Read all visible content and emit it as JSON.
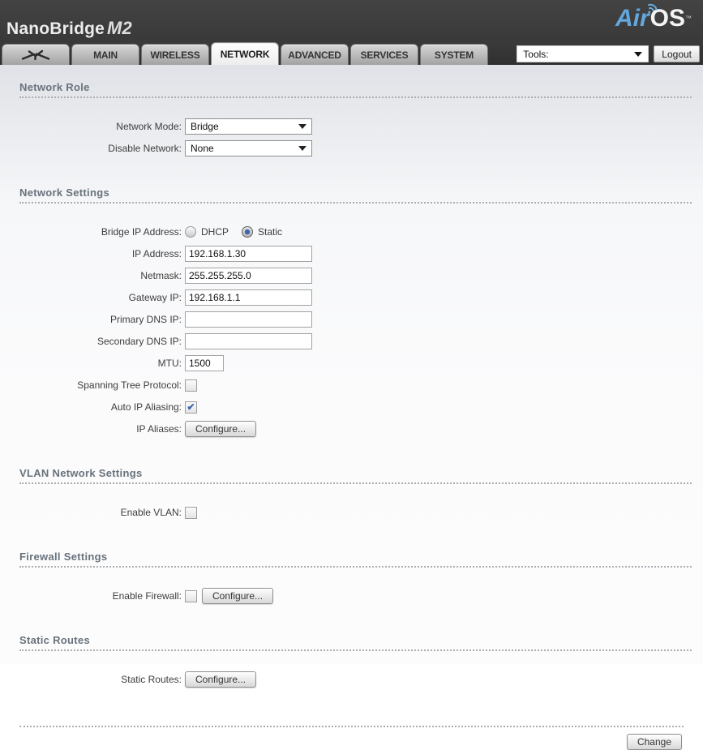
{
  "colors": {
    "brand_blue": "#64a7dc",
    "accent_blue": "#3f63ad"
  },
  "header": {
    "brand_name": "NanoBridge",
    "brand_model": "M2",
    "logo_air": "Air",
    "logo_os": "OS",
    "logo_tm": "™"
  },
  "tabs": [
    {
      "label": "",
      "icon": "ubiquiti-logo",
      "active": false
    },
    {
      "label": "MAIN",
      "active": false
    },
    {
      "label": "WIRELESS",
      "active": false
    },
    {
      "label": "NETWORK",
      "active": true
    },
    {
      "label": "ADVANCED",
      "active": false
    },
    {
      "label": "SERVICES",
      "active": false
    },
    {
      "label": "SYSTEM",
      "active": false
    }
  ],
  "toolbar": {
    "tools_label": "Tools:",
    "logout_label": "Logout"
  },
  "sections": [
    {
      "title": "Network Role",
      "rows": [
        {
          "label": "Network Mode:",
          "type": "select",
          "value": "Bridge"
        },
        {
          "label": "Disable Network:",
          "type": "select",
          "value": "None"
        }
      ]
    },
    {
      "title": "Network Settings",
      "rows": [
        {
          "label": "Bridge IP Address:",
          "type": "radios",
          "options": [
            {
              "label": "DHCP",
              "selected": false
            },
            {
              "label": "Static",
              "selected": true
            }
          ]
        },
        {
          "label": "IP Address:",
          "type": "text",
          "value": "192.168.1.30"
        },
        {
          "label": "Netmask:",
          "type": "text",
          "value": "255.255.255.0"
        },
        {
          "label": "Gateway IP:",
          "type": "text",
          "value": "192.168.1.1"
        },
        {
          "label": "Primary DNS IP:",
          "type": "text",
          "value": ""
        },
        {
          "label": "Secondary DNS IP:",
          "type": "text",
          "value": ""
        },
        {
          "label": "MTU:",
          "type": "text",
          "value": "1500",
          "small": true
        },
        {
          "label": "Spanning Tree Protocol:",
          "type": "checkbox",
          "checked": false
        },
        {
          "label": "Auto IP Aliasing:",
          "type": "checkbox",
          "checked": true
        },
        {
          "label": "IP Aliases:",
          "type": "button",
          "button": "Configure..."
        }
      ]
    },
    {
      "title": "VLAN Network Settings",
      "rows": [
        {
          "label": "Enable VLAN:",
          "type": "checkbox",
          "checked": false
        }
      ]
    },
    {
      "title": "Firewall Settings",
      "rows": [
        {
          "label": "Enable Firewall:",
          "type": "checkbox-button",
          "checked": false,
          "button": "Configure..."
        }
      ]
    },
    {
      "title": "Static Routes",
      "rows": [
        {
          "label": "Static Routes:",
          "type": "button",
          "button": "Configure..."
        }
      ]
    }
  ],
  "footer": {
    "change_label": "Change"
  },
  "check_glyph": "✔"
}
